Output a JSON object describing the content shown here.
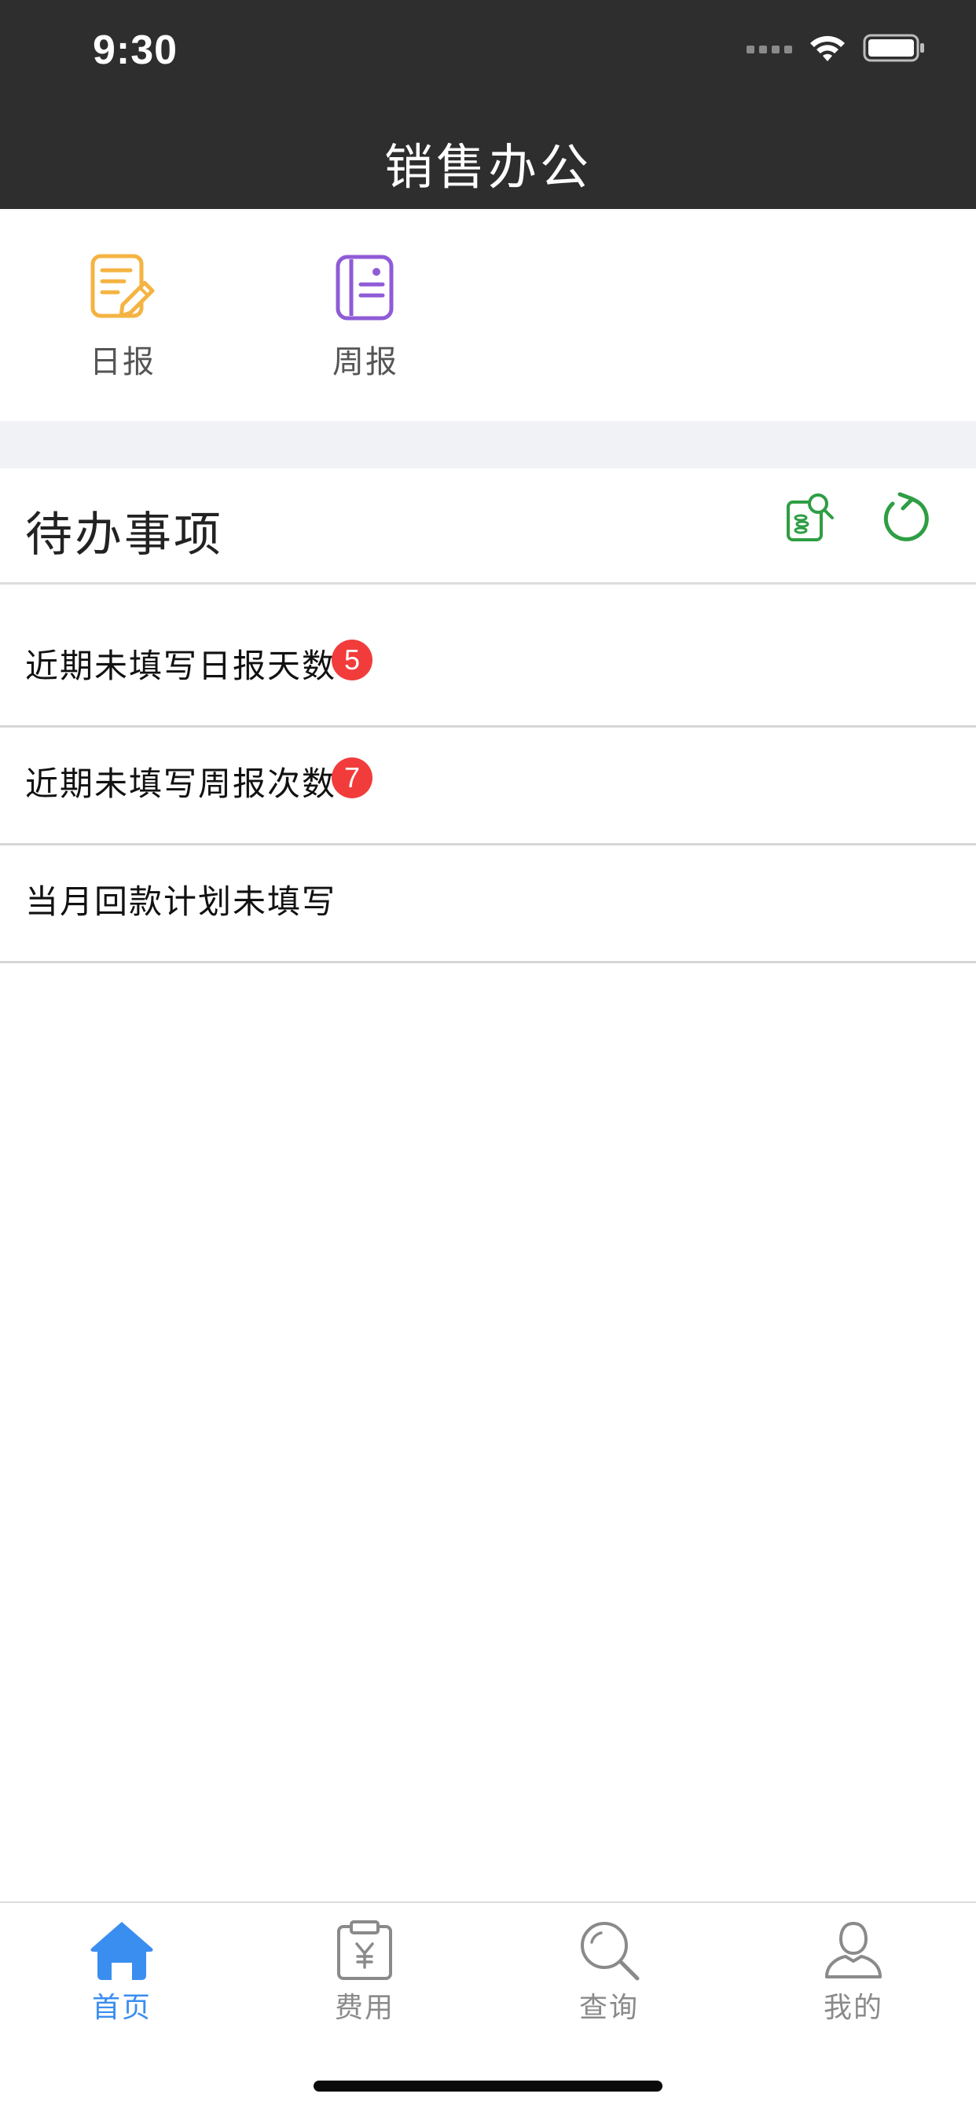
{
  "status_bar": {
    "time": "9:30"
  },
  "nav": {
    "title": "销售办公"
  },
  "quick_actions": [
    {
      "label": "日报",
      "icon": "daily-report-icon",
      "color": "#f5b342"
    },
    {
      "label": "周报",
      "icon": "weekly-report-icon",
      "color": "#8f5bd6"
    }
  ],
  "todo": {
    "title": "待办事项",
    "tools": [
      {
        "icon": "search-document-icon",
        "color": "#2f9e44"
      },
      {
        "icon": "refresh-icon",
        "color": "#2f9e44"
      }
    ],
    "items": [
      {
        "label": "近期未填写日报天数",
        "badge": "5"
      },
      {
        "label": "近期未填写周报次数",
        "badge": "7"
      },
      {
        "label": "当月回款计划未填写",
        "badge": ""
      }
    ]
  },
  "tabbar": {
    "active_color": "#3a8ef0",
    "inactive_color": "#8a8a8a",
    "tabs": [
      {
        "label": "首页",
        "icon": "home-icon",
        "active": true
      },
      {
        "label": "费用",
        "icon": "expense-clipboard-icon",
        "active": false
      },
      {
        "label": "查询",
        "icon": "search-icon",
        "active": false
      },
      {
        "label": "我的",
        "icon": "user-icon",
        "active": false
      }
    ]
  }
}
